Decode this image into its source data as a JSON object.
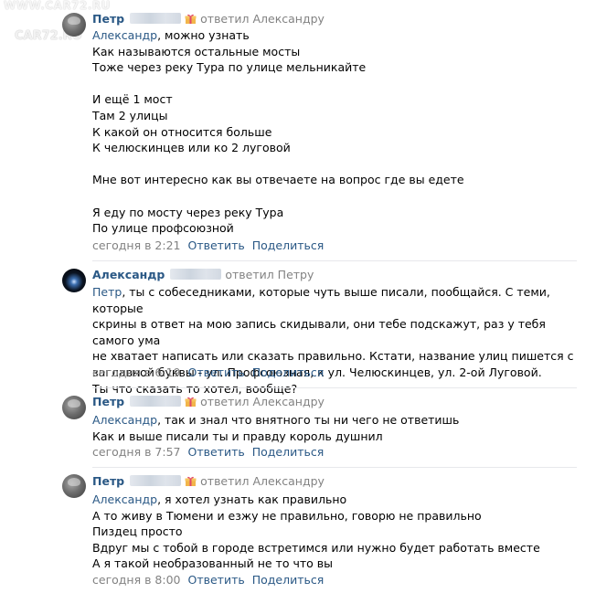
{
  "watermark": {
    "top": "WWW.CAR72.RU",
    "logo": "CAR72.RO"
  },
  "comments": [
    {
      "author": "Петр",
      "replied_text": "ответил Александру",
      "lines": [
        {
          "mention": "Александр",
          "text": ", можно узнать"
        },
        {
          "text": "Как называются остальные мосты"
        },
        {
          "text": "Тоже через реку Тура по улице мельникайте"
        },
        {
          "text": ""
        },
        {
          "text": "И ещё 1 мост"
        },
        {
          "text": "Там 2 улицы"
        },
        {
          "text": "К какой он относится больше"
        },
        {
          "text": "К челюскинцев или ко 2 луговой"
        },
        {
          "text": ""
        },
        {
          "text": "Мне вот интересно как вы отвечаете на вопрос где вы едете"
        },
        {
          "text": ""
        },
        {
          "text": "Я еду по мосту через реку Тура"
        },
        {
          "text": "По улице профсоюзной"
        }
      ],
      "time": "сегодня в 2:21",
      "reply_label": "Ответить",
      "share_label": "Поделиться"
    },
    {
      "author": "Александр",
      "replied_text": "ответил Петру",
      "lines": [
        {
          "mention": "Петр",
          "text": ", ты с собеседниками, которые чуть выше писали, пообщайся. С теми, которые"
        },
        {
          "text": "скрины в ответ на мою запись скидывали, они тебе подскажут, раз у тебя самого ума"
        },
        {
          "text": "не хватает написать или сказать правильно. Кстати, название улиц пишется с"
        },
        {
          "text": "заглавной буквы - ул. Профсоюзная, к ул. Челюскинцев, ул. 2-ой Луговой."
        },
        {
          "text": "Ты что сказать то хотел, вообще?"
        }
      ],
      "time": "сегодня в 6:19",
      "reply_label": "Ответить",
      "share_label": "Поделиться"
    },
    {
      "author": "Петр",
      "replied_text": "ответил Александру",
      "lines": [
        {
          "mention": "Александр",
          "text": ", так и знал что внятного ты ни чего не ответишь"
        },
        {
          "text": "Как и выше писали ты и правду король душнил"
        }
      ],
      "time": "сегодня в 7:57",
      "reply_label": "Ответить",
      "share_label": "Поделиться"
    },
    {
      "author": "Петр",
      "replied_text": "ответил Александру",
      "lines": [
        {
          "mention": "Александр",
          "text": ", я хотел узнать как правильно"
        },
        {
          "text": "А то живу в Тюмени и езжу не правильно, говорю не правильно"
        },
        {
          "text": "Пиздец просто"
        },
        {
          "text": "Вдруг мы с тобой в городе встретимся или нужно будет работать вместе"
        },
        {
          "text": "А я такой необразованный не то что вы"
        }
      ],
      "time": "сегодня в 8:00",
      "reply_label": "Ответить",
      "share_label": "Поделиться"
    }
  ]
}
